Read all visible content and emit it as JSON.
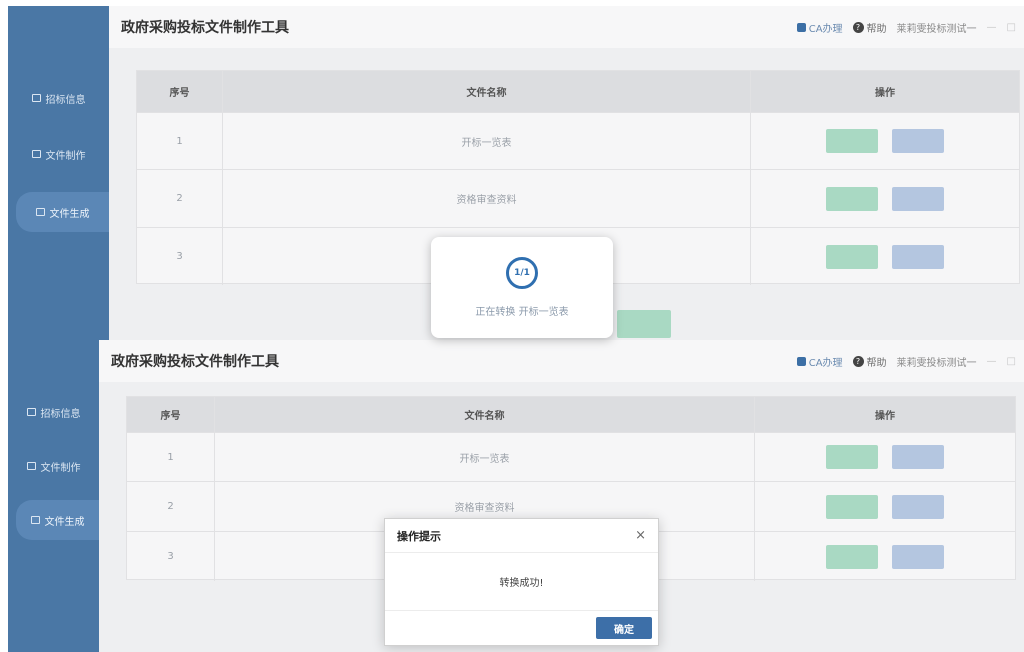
{
  "app_title": "政府采购投标文件制作工具",
  "header": {
    "ca_label": "CA办理",
    "help_label": "帮助",
    "user_name": "莱莉雯投标测试一",
    "minimize": "—",
    "maximize": "□"
  },
  "sidebar": {
    "items": [
      {
        "label": "招标信息"
      },
      {
        "label": "文件制作"
      },
      {
        "label": "文件生成"
      }
    ]
  },
  "table": {
    "headers": [
      "序号",
      "文件名称",
      "操作"
    ],
    "rows": [
      {
        "index": "1",
        "name": "开标一览表"
      },
      {
        "index": "2",
        "name": "资格审查资料"
      },
      {
        "index": "3",
        "name": ""
      }
    ]
  },
  "loading": {
    "progress": "1/1",
    "text": "正在转换 开标一览表"
  },
  "dialog": {
    "title": "操作提示",
    "close": "×",
    "message": "转换成功!",
    "ok_label": "确定"
  },
  "colors": {
    "sidebar": "#4a77a5",
    "accent": "#3d6fa8",
    "green_button": "#a9d9c3"
  }
}
